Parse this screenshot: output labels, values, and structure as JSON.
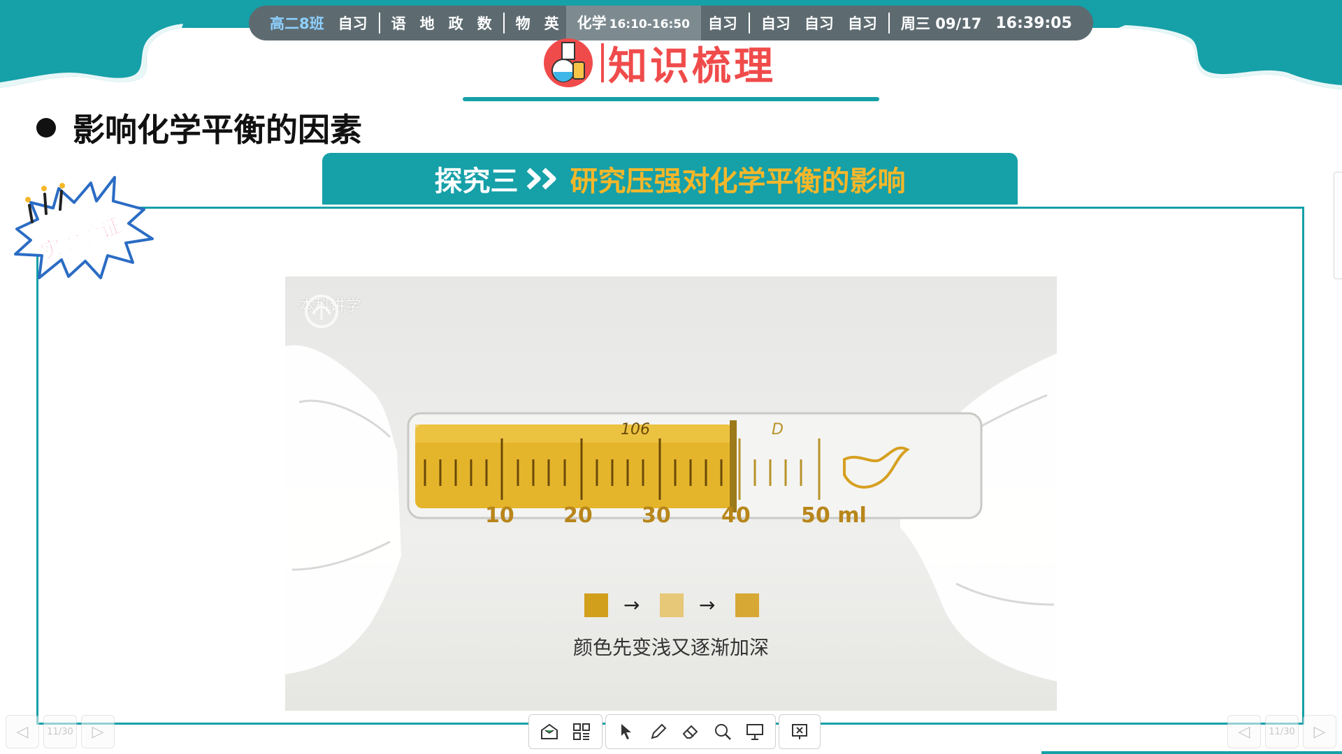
{
  "schedule": {
    "class_name": "高二8班",
    "items": [
      "自习",
      "语",
      "地",
      "政",
      "数",
      "物",
      "英"
    ],
    "current": {
      "subject": "化学",
      "time": "16:10-16:50"
    },
    "after": [
      "自习",
      "自习",
      "自习",
      "自习"
    ],
    "weekday_date": "周三 09/17",
    "clock": "16:39:05"
  },
  "page": {
    "title": "知识梳理",
    "heading": "影响化学平衡的因素",
    "explore_label": "探究三",
    "explore_topic": "研究压强对化学平衡的影响",
    "badge_text": "实验验证"
  },
  "video": {
    "watermark": "本科讲学",
    "caption": "颜色先变浅又逐渐加深",
    "syringe_brand": "106",
    "syringe_letter": "D",
    "scale_labels": [
      "10",
      "20",
      "30",
      "40",
      "50 ml"
    ],
    "color_swatches": [
      "#d19f1c",
      "#e7c778",
      "#d7a834"
    ]
  },
  "pager": {
    "page_label": "11/30"
  },
  "colors": {
    "teal": "#16a0a8",
    "title_red": "#f04b4b",
    "topic_yellow": "#f5b72a"
  },
  "toolbar": {
    "icons": [
      "inbox-icon",
      "grid-icon",
      "cursor-icon",
      "pen-icon",
      "eraser-icon",
      "search-icon",
      "whiteboard-icon",
      "exit-icon"
    ]
  }
}
